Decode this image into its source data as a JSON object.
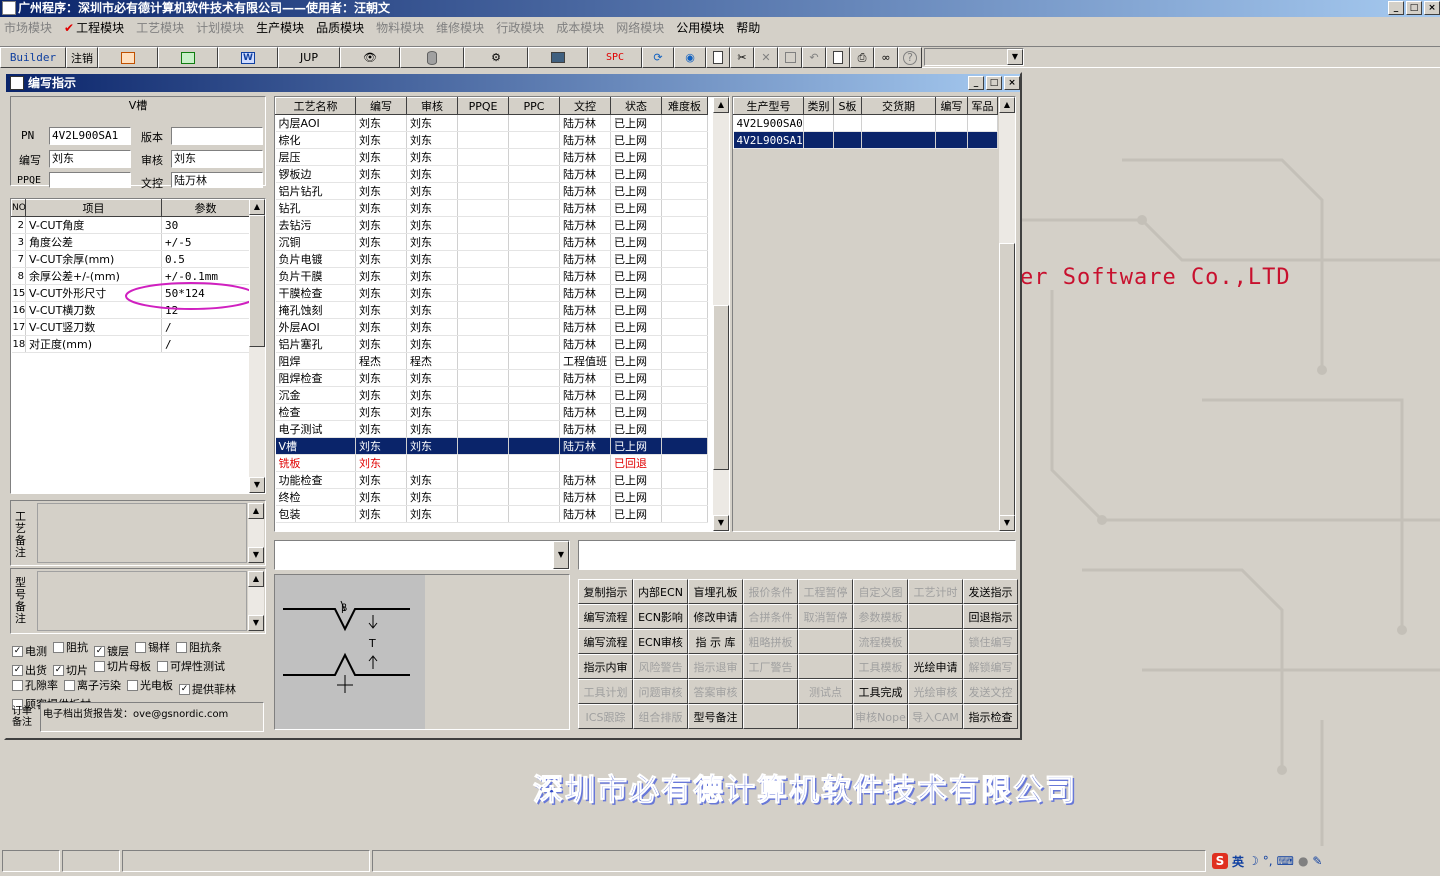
{
  "app_title": "广州程序：深圳市必有德计算机软件技术有限公司——使用者：汪朝文",
  "window_buttons": [
    "_",
    "□",
    "×"
  ],
  "menu": [
    {
      "label": "市场模块",
      "enabled": false
    },
    {
      "label": "工程模块",
      "enabled": true,
      "checked": true
    },
    {
      "label": "工艺模块",
      "enabled": false
    },
    {
      "label": "计划模块",
      "enabled": false
    },
    {
      "label": "生产模块",
      "enabled": true
    },
    {
      "label": "品质模块",
      "enabled": true
    },
    {
      "label": "物料模块",
      "enabled": false
    },
    {
      "label": "维修模块",
      "enabled": false
    },
    {
      "label": "行政模块",
      "enabled": false
    },
    {
      "label": "成本模块",
      "enabled": false
    },
    {
      "label": "网络模块",
      "enabled": false
    },
    {
      "label": "公用模块",
      "enabled": true
    },
    {
      "label": "帮助",
      "enabled": true
    }
  ],
  "toolbar": {
    "builder": "Builder",
    "logout": "注销",
    "jup": "JUP",
    "spc": "SPC",
    "icons": [
      "ppt-icon",
      "excel-icon",
      "word-icon",
      "jup-icon",
      "eye-icon",
      "database-icon",
      "network-icon",
      "monitor-icon",
      "spc-icon",
      "refresh-icon",
      "globe-icon",
      "new-doc-icon",
      "cut-icon",
      "delete-icon",
      "save-icon",
      "undo-icon",
      "preview-icon",
      "print-icon",
      "binoculars-icon",
      "help-icon"
    ]
  },
  "child_window": {
    "title": "编写指示",
    "buttons": [
      "_",
      "□",
      "×"
    ],
    "process_name": "V槽",
    "pn_label": "PN",
    "pn_value": "4V2L900SA1",
    "version_label": "版本",
    "version_value": "",
    "author_label": "编写",
    "author_value": "刘东",
    "reviewer_label": "审核",
    "reviewer_value": "刘东",
    "ppqe_label": "PPQE",
    "ppqe_value": "",
    "control_label": "文控",
    "control_value": "陆万林"
  },
  "params": {
    "headers": [
      "NO",
      "项目",
      "参数"
    ],
    "rows": [
      [
        "2",
        "V-CUT角度",
        "30"
      ],
      [
        "3",
        "角度公差",
        "+/-5"
      ],
      [
        "7",
        "V-CUT余厚(mm)",
        "0.5"
      ],
      [
        "8",
        "余厚公差+/-(mm)",
        "+/-0.1mm"
      ],
      [
        "15",
        "V-CUT外形尺寸",
        "50*124"
      ],
      [
        "16",
        "V-CUT横刀数",
        "12"
      ],
      [
        "17",
        "V-CUT竖刀数",
        "/"
      ],
      [
        "18",
        "对正度(mm)",
        "/"
      ]
    ],
    "highlighted_row": 4
  },
  "remarks": {
    "process_label": "工艺备注",
    "model_label": "型号备注",
    "order_label": "订单备注",
    "order_value": "电子档出货报告发：ove@gsnordic.com"
  },
  "checkboxes": [
    [
      {
        "label": "电测",
        "checked": true
      },
      {
        "label": "阻抗",
        "checked": false
      },
      {
        "label": "镀层",
        "checked": true
      },
      {
        "label": "锡样",
        "checked": false
      },
      {
        "label": "阻抗条",
        "checked": false
      }
    ],
    [
      {
        "label": "出货",
        "checked": true
      },
      {
        "label": "切片",
        "checked": true
      },
      {
        "label": "切片母板",
        "checked": false
      },
      {
        "label": "可焊性测试",
        "checked": false
      }
    ],
    [
      {
        "label": "孔隙率",
        "checked": false
      },
      {
        "label": "离子污染",
        "checked": false
      },
      {
        "label": "光电板",
        "checked": false
      },
      {
        "label": "提供菲林",
        "checked": true
      }
    ],
    [
      {
        "label": "顾客提供板材",
        "checked": false
      }
    ]
  ],
  "process_table": {
    "headers": [
      "工艺名称",
      "编写",
      "审核",
      "PPQE",
      "PPC",
      "文控",
      "状态",
      "难度板"
    ],
    "rows": [
      [
        "内层AOI",
        "刘东",
        "刘东",
        "",
        "",
        "陆万林",
        "已上网",
        ""
      ],
      [
        "棕化",
        "刘东",
        "刘东",
        "",
        "",
        "陆万林",
        "已上网",
        ""
      ],
      [
        "层压",
        "刘东",
        "刘东",
        "",
        "",
        "陆万林",
        "已上网",
        ""
      ],
      [
        "锣板边",
        "刘东",
        "刘东",
        "",
        "",
        "陆万林",
        "已上网",
        ""
      ],
      [
        "铝片钻孔",
        "刘东",
        "刘东",
        "",
        "",
        "陆万林",
        "已上网",
        ""
      ],
      [
        "钻孔",
        "刘东",
        "刘东",
        "",
        "",
        "陆万林",
        "已上网",
        ""
      ],
      [
        "去钻污",
        "刘东",
        "刘东",
        "",
        "",
        "陆万林",
        "已上网",
        ""
      ],
      [
        "沉铜",
        "刘东",
        "刘东",
        "",
        "",
        "陆万林",
        "已上网",
        ""
      ],
      [
        "负片电镀",
        "刘东",
        "刘东",
        "",
        "",
        "陆万林",
        "已上网",
        ""
      ],
      [
        "负片干膜",
        "刘东",
        "刘东",
        "",
        "",
        "陆万林",
        "已上网",
        ""
      ],
      [
        "干膜检查",
        "刘东",
        "刘东",
        "",
        "",
        "陆万林",
        "已上网",
        ""
      ],
      [
        "掩孔蚀刻",
        "刘东",
        "刘东",
        "",
        "",
        "陆万林",
        "已上网",
        ""
      ],
      [
        "外层AOI",
        "刘东",
        "刘东",
        "",
        "",
        "陆万林",
        "已上网",
        ""
      ],
      [
        "铝片塞孔",
        "刘东",
        "刘东",
        "",
        "",
        "陆万林",
        "已上网",
        ""
      ],
      [
        "阻焊",
        "程杰",
        "程杰",
        "",
        "",
        "工程值班",
        "已上网",
        ""
      ],
      [
        "阻焊检查",
        "刘东",
        "刘东",
        "",
        "",
        "陆万林",
        "已上网",
        ""
      ],
      [
        "沉金",
        "刘东",
        "刘东",
        "",
        "",
        "陆万林",
        "已上网",
        ""
      ],
      [
        "检查",
        "刘东",
        "刘东",
        "",
        "",
        "陆万林",
        "已上网",
        ""
      ],
      [
        "电子测试",
        "刘东",
        "刘东",
        "",
        "",
        "陆万林",
        "已上网",
        ""
      ],
      [
        "V槽",
        "刘东",
        "刘东",
        "",
        "",
        "陆万林",
        "已上网",
        ""
      ],
      [
        "铣板",
        "刘东",
        "",
        "",
        "",
        "",
        "已回退",
        ""
      ],
      [
        "功能检查",
        "刘东",
        "刘东",
        "",
        "",
        "陆万林",
        "已上网",
        ""
      ],
      [
        "终检",
        "刘东",
        "刘东",
        "",
        "",
        "陆万林",
        "已上网",
        ""
      ],
      [
        "包装",
        "刘东",
        "刘东",
        "",
        "",
        "陆万林",
        "已上网",
        ""
      ]
    ],
    "selected_row": 19,
    "returned_row": 20
  },
  "model_table": {
    "headers": [
      "生产型号",
      "类别",
      "S板",
      "交货期",
      "编写",
      "军品"
    ],
    "rows": [
      [
        "4V2L900SA0",
        "",
        "",
        "",
        "",
        ""
      ],
      [
        "4V2L900SA1",
        "",
        "",
        "",
        "",
        ""
      ]
    ],
    "selected_row": 1
  },
  "diagram": {
    "label_beta": "β",
    "label_t": "T"
  },
  "action_buttons": [
    [
      {
        "label": "复制指示",
        "enabled": true
      },
      {
        "label": "内部ECN",
        "enabled": true
      },
      {
        "label": "盲埋孔板",
        "enabled": true
      },
      {
        "label": "报价条件",
        "enabled": false
      },
      {
        "label": "工程暂停",
        "enabled": false
      },
      {
        "label": "自定义图",
        "enabled": false
      },
      {
        "label": "工艺计时",
        "enabled": false
      },
      {
        "label": "发送指示",
        "enabled": true
      }
    ],
    [
      {
        "label": "编写流程",
        "enabled": true
      },
      {
        "label": "ECN影响",
        "enabled": true
      },
      {
        "label": "修改申请",
        "enabled": true
      },
      {
        "label": "合拼条件",
        "enabled": false
      },
      {
        "label": "取消暂停",
        "enabled": false
      },
      {
        "label": "参数模板",
        "enabled": false
      },
      {
        "label": "",
        "enabled": false
      },
      {
        "label": "回退指示",
        "enabled": true
      }
    ],
    [
      {
        "label": "编写流程",
        "enabled": true
      },
      {
        "label": "ECN审核",
        "enabled": true
      },
      {
        "label": "指 示 库",
        "enabled": true
      },
      {
        "label": "粗略拼板",
        "enabled": false
      },
      {
        "label": "",
        "enabled": false
      },
      {
        "label": "流程模板",
        "enabled": false
      },
      {
        "label": "",
        "enabled": false
      },
      {
        "label": "锁住编写",
        "enabled": false
      }
    ],
    [
      {
        "label": "指示内审",
        "enabled": true
      },
      {
        "label": "风险警告",
        "enabled": false
      },
      {
        "label": "指示退审",
        "enabled": false
      },
      {
        "label": "工厂警告",
        "enabled": false
      },
      {
        "label": "",
        "enabled": false
      },
      {
        "label": "工具模板",
        "enabled": false
      },
      {
        "label": "光绘申请",
        "enabled": true
      },
      {
        "label": "解锁编写",
        "enabled": false
      }
    ],
    [
      {
        "label": "工具计划",
        "enabled": false
      },
      {
        "label": "问题审核",
        "enabled": false
      },
      {
        "label": "答案审核",
        "enabled": false
      },
      {
        "label": "",
        "enabled": false
      },
      {
        "label": "测试点",
        "enabled": false
      },
      {
        "label": "工具完成",
        "enabled": true
      },
      {
        "label": "光绘审核",
        "enabled": false
      },
      {
        "label": "发送文控",
        "enabled": false
      }
    ],
    [
      {
        "label": "ICS跟踪",
        "enabled": false
      },
      {
        "label": "组合排版",
        "enabled": false
      },
      {
        "label": "型号备注",
        "enabled": true
      },
      {
        "label": "",
        "enabled": false
      },
      {
        "label": "",
        "enabled": false
      },
      {
        "label": "审核Nope",
        "enabled": false
      },
      {
        "label": "导入CAM",
        "enabled": false
      },
      {
        "label": "指示检查",
        "enabled": true
      }
    ]
  ],
  "desktop": {
    "software_text": "er Software Co.,LTD",
    "company_text": "深圳市必有德计算机软件技术有限公司"
  },
  "tray": {
    "ime": "英"
  },
  "colors": {
    "title_start": "#0a246a",
    "title_end": "#a6caf0",
    "selection": "#0a246a",
    "returned": "#e00000",
    "highlight_ellipse": "#d020c0",
    "desktop_text": "#c8102e",
    "company_text": "#3048c8"
  }
}
